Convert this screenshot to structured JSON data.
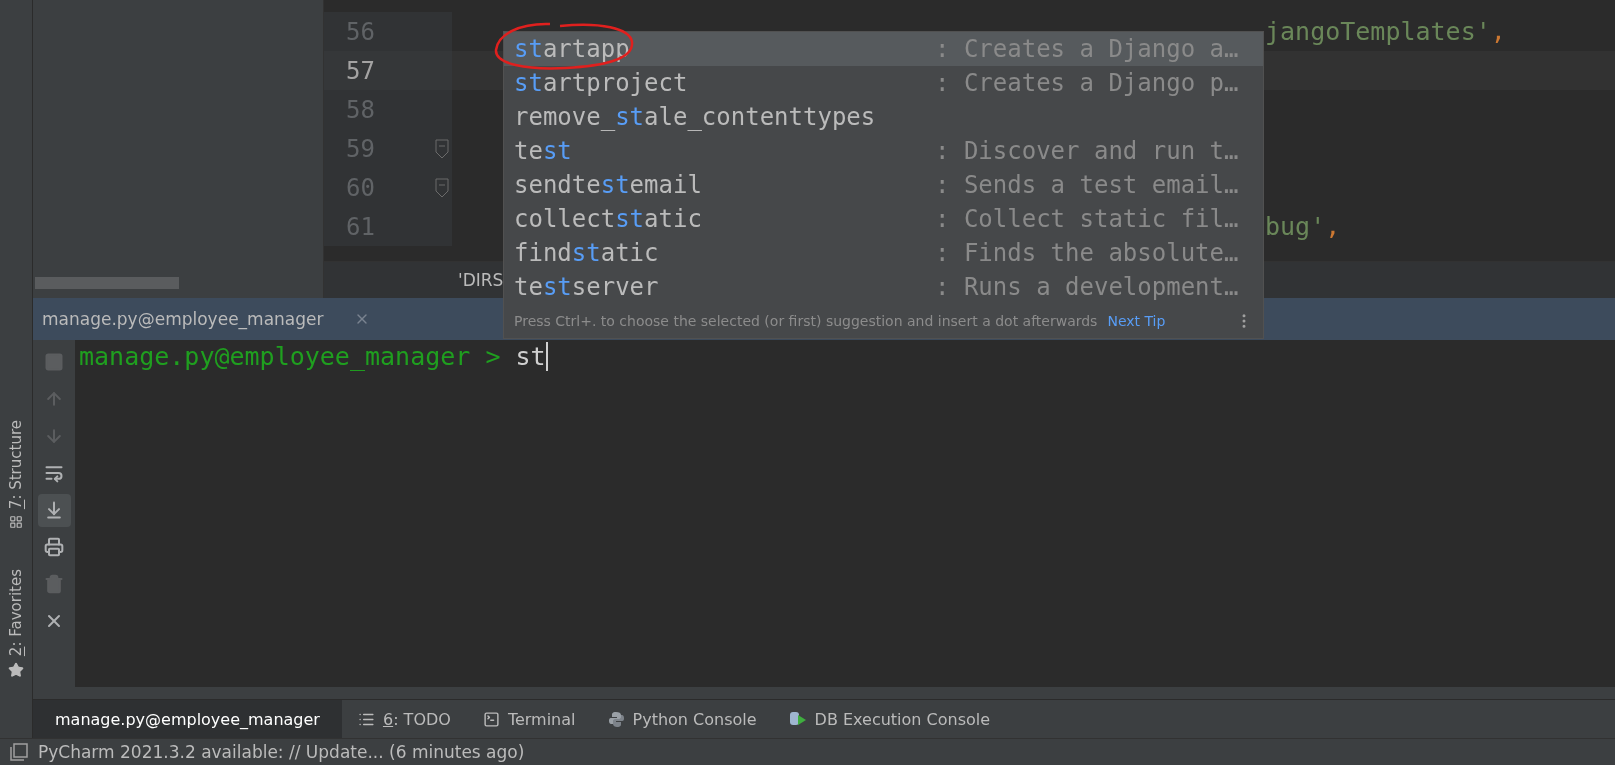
{
  "editor": {
    "lines": [
      {
        "number": "56",
        "kind": "tail",
        "current": false,
        "fold": false,
        "parts": [
          {
            "text": "jangoTemplates'",
            "kind": "string"
          },
          {
            "text": ",",
            "kind": "punct"
          }
        ]
      },
      {
        "number": "57",
        "current": true,
        "fold": false
      },
      {
        "number": "58",
        "current": false,
        "fold": false
      },
      {
        "number": "59",
        "current": false,
        "fold": true
      },
      {
        "number": "60",
        "current": false,
        "fold": true
      },
      {
        "number": "61",
        "kind": "tail",
        "current": false,
        "fold": false,
        "parts": [
          {
            "text": "bug'",
            "kind": "string"
          },
          {
            "text": ",",
            "kind": "punct"
          }
        ]
      }
    ],
    "breadcrumb": "'DIRS"
  },
  "completion": {
    "items": [
      {
        "match": "st",
        "after": "artapp",
        "description": ": Creates a Django a…",
        "selected": true
      },
      {
        "match": "st",
        "after": "artproject",
        "description": ": Creates a Django p…",
        "selected": false
      },
      {
        "before": "remove_",
        "match": "st",
        "after": "ale_contenttypes",
        "selected": false
      },
      {
        "before": "te",
        "match": "st",
        "description": ": Discover and run t…",
        "selected": false
      },
      {
        "before": "sendte",
        "match": "st",
        "after": "email",
        "description": ": Sends a test email…",
        "selected": false
      },
      {
        "before": "collect",
        "match": "st",
        "after": "atic",
        "description": ": Collect static fil…",
        "selected": false
      },
      {
        "before": "find",
        "match": "st",
        "after": "atic",
        "description": ": Finds the absolute…",
        "selected": false
      },
      {
        "before": "te",
        "match": "st",
        "after": "server",
        "description": ": Runs a development…",
        "selected": false
      }
    ],
    "hint": "Press Ctrl+. to choose the selected (or first) suggestion and insert a dot afterwards",
    "link": "Next Tip"
  },
  "console": {
    "tab": "manage.py@employee_manager",
    "prompt": "manage.py@employee_manager > ",
    "input": "st",
    "toolbar": [
      {
        "disabled": true,
        "selected": false
      },
      {
        "disabled": true,
        "selected": false
      },
      {
        "disabled": true,
        "selected": false
      },
      {
        "disabled": false,
        "selected": false
      },
      {
        "disabled": false,
        "selected": true
      },
      {
        "disabled": false,
        "selected": false
      },
      {
        "disabled": true,
        "selected": false
      },
      {
        "disabled": false,
        "selected": false
      }
    ]
  },
  "side_tabs": [
    {
      "label": "7: Structure",
      "mnemonic": true
    },
    {
      "label": "2: Favorites",
      "mnemonic": true
    }
  ],
  "bottom_tabs": [
    {
      "label": "manage.py@employee_manager",
      "selected": true,
      "mnemonic": false
    },
    {
      "label": "6: TODO",
      "selected": false,
      "mnemonic": true
    },
    {
      "label": "Terminal",
      "selected": false,
      "mnemonic": false
    },
    {
      "label": "Python Console",
      "selected": false,
      "mnemonic": false
    },
    {
      "label": "DB Execution Console",
      "selected": false,
      "mnemonic": false
    }
  ],
  "status_bar": {
    "text": "PyCharm 2021.3.2 available: // Update... (6 minutes ago)"
  }
}
